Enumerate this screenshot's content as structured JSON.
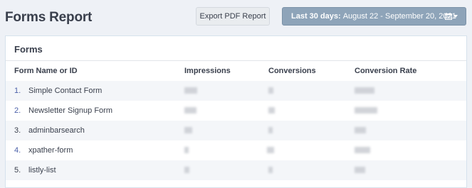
{
  "header": {
    "title": "Forms Report",
    "export_label": "Export PDF Report",
    "date_prefix": "Last 30 days:",
    "date_range": "August 22 - September 20, 2021",
    "calendar_icon": "calendar-icon",
    "caret_icon": "caret-down-icon"
  },
  "card": {
    "title": "Forms",
    "columns": [
      "Form Name or ID",
      "Impressions",
      "Conversions",
      "Conversion Rate"
    ],
    "rows": [
      {
        "index": "1.",
        "name": "Simple Contact Form"
      },
      {
        "index": "2.",
        "name": "Newsletter Signup Form"
      },
      {
        "index": "3.",
        "name": "adminbarsearch"
      },
      {
        "index": "4.",
        "name": "xpather-form"
      },
      {
        "index": "5.",
        "name": "listly-list"
      }
    ]
  },
  "colors": {
    "background": "#eef1f6",
    "date_button": "#8ea4b9",
    "link_index": "#4a5fa8",
    "text": "#393f4c"
  }
}
